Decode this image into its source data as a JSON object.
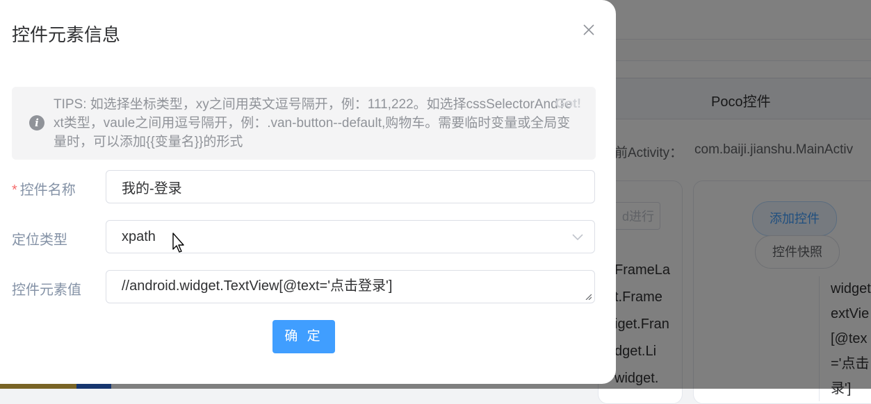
{
  "background": {
    "tab_title": "Poco控件",
    "activity_label": "前Activity：",
    "activity_value": "com.baiji.jianshu.MainActiv",
    "progress_button": "d进行",
    "add_control_button": "添加控件",
    "snapshot_button": "控件快照",
    "tree_items": [
      "FrameLa",
      "t.Frame",
      "iget.Fran",
      "dget.Li",
      "widget."
    ],
    "xpath_lines": [
      "widget",
      "extVie",
      "[@tex",
      "='点击",
      "录']"
    ]
  },
  "dialog": {
    "title": "控件元素信息",
    "close_icon": "close-icon",
    "tips": {
      "icon": "info-icon",
      "text": "TIPS: 如选择坐标类型，xy之间用英文逗号隔开，例：111,222。如选择cssSelectorAndText类型，vaule之间用逗号隔开，例：.van-button--default,购物车。需要临时变量或全局变量时，可以添加{{变量名}}的形式",
      "close_label": "Got!"
    },
    "fields": {
      "name": {
        "required_mark": "*",
        "label": "控件名称",
        "value": "我的-登录"
      },
      "locator_type": {
        "label": "定位类型",
        "value": "xpath"
      },
      "element_value": {
        "label": "控件元素值",
        "value": "//android.widget.TextView[@text='点击登录']"
      }
    },
    "confirm_button": "确 定"
  },
  "colors": {
    "primary": "#409eff",
    "required": "#f56c6c",
    "label": "#8492a6",
    "tips_bg": "#f4f4f5"
  }
}
